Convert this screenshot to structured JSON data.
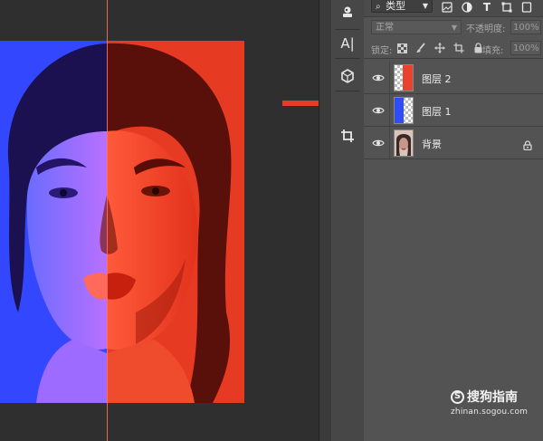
{
  "filter": {
    "kind_label": "类型",
    "kind_icon": "search-icon"
  },
  "blend": {
    "mode": "正常",
    "opacity_label": "不透明度:",
    "opacity_value": "100%"
  },
  "lock": {
    "label": "锁定:",
    "fill_label": "填充:",
    "fill_value": "100%"
  },
  "layers": [
    {
      "name": "图层 2",
      "thumbnail_color": "#e8432e"
    },
    {
      "name": "图层 1",
      "thumbnail_color": "#2f4df0"
    },
    {
      "name": "背景",
      "locked": true
    }
  ],
  "tools": [
    "stamp-icon",
    "character-text-icon",
    "3d-cube-icon",
    "crop-icon"
  ],
  "watermark": {
    "brand": "搜狗指南",
    "url": "zhinan.sogou.com"
  },
  "colors": {
    "accent_arrow": "#e23d2b",
    "guide_line": "#ff6b6b",
    "left_tint": "#3d4dff",
    "right_tint": "#e83a22",
    "mid_tint": "#b04cff"
  }
}
